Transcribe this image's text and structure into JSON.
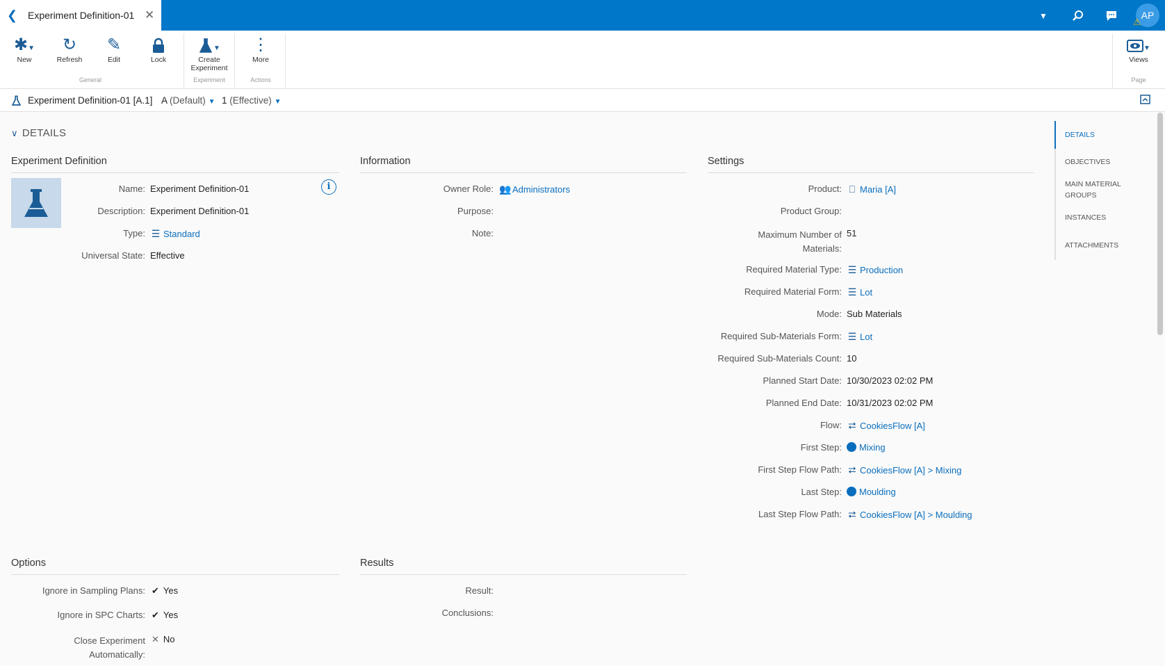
{
  "tab": {
    "title": "Experiment Definition-01"
  },
  "user": {
    "initials": "AP"
  },
  "ribbon": {
    "buttons": [
      "New",
      "Refresh",
      "Edit",
      "Lock",
      "Create Experiment",
      "More",
      "Views"
    ],
    "groups": [
      "General",
      "Experiment",
      "Actions",
      "Page"
    ]
  },
  "header": {
    "entity": "Experiment Definition-01 [A.1]",
    "revision_key": "A",
    "revision": "(Default)",
    "version_key": "1",
    "version": "(Effective)"
  },
  "section": {
    "title": "DETAILS"
  },
  "experiment_definition": {
    "heading": "Experiment Definition",
    "fields": [
      {
        "label": "Name:",
        "value": "Experiment Definition-01"
      },
      {
        "label": "Description:",
        "value": "Experiment Definition-01"
      },
      {
        "label": "Type:",
        "value": "Standard"
      },
      {
        "label": "Universal State:",
        "value": "Effective"
      }
    ]
  },
  "information": {
    "heading": "Information",
    "fields": [
      {
        "label": "Owner Role:",
        "value": "Administrators"
      },
      {
        "label": "Purpose:",
        "value": ""
      },
      {
        "label": "Note:",
        "value": ""
      }
    ]
  },
  "settings": {
    "heading": "Settings",
    "fields": [
      {
        "label": "Product:",
        "value": "Maria [A]"
      },
      {
        "label": "Product Group:",
        "value": ""
      },
      {
        "label_l1": "Maximum Number of",
        "label_l2": "Materials:",
        "value": "51"
      },
      {
        "label": "Required Material Type:",
        "value": "Production"
      },
      {
        "label": "Required Material Form:",
        "value": "Lot"
      },
      {
        "label": "Mode:",
        "value": "Sub Materials"
      },
      {
        "label": "Required Sub-Materials Form:",
        "value": "Lot"
      },
      {
        "label": "Required Sub-Materials Count:",
        "value": "10"
      },
      {
        "label": "Planned Start Date:",
        "value": "10/30/2023 02:02 PM"
      },
      {
        "label": "Planned End Date:",
        "value": "10/31/2023 02:02 PM"
      },
      {
        "label": "Flow:",
        "value": "CookiesFlow [A]"
      },
      {
        "label": "First Step:",
        "value": "Mixing"
      },
      {
        "label": "First Step Flow Path:",
        "value": "CookiesFlow [A] > Mixing"
      },
      {
        "label": "Last Step:",
        "value": "Moulding"
      },
      {
        "label": "Last Step Flow Path:",
        "value": "CookiesFlow [A] > Moulding"
      }
    ]
  },
  "options": {
    "heading": "Options",
    "fields": [
      {
        "label": "Ignore in Sampling Plans:",
        "value": "Yes"
      },
      {
        "label": "Ignore in SPC Charts:",
        "value": "Yes"
      },
      {
        "label_l1": "Close Experiment",
        "label_l2": "Automatically:",
        "value": "No"
      }
    ]
  },
  "results": {
    "heading": "Results",
    "fields": [
      {
        "label": "Result:",
        "value": ""
      },
      {
        "label": "Conclusions:",
        "value": ""
      }
    ]
  },
  "right_nav": [
    "DETAILS",
    "OBJECTIVES",
    "MAIN MATERIAL",
    "GROUPS",
    "INSTANCES",
    "ATTACHMENTS"
  ],
  "colors": {
    "brand": "#0077c8",
    "link": "#0a6ebd"
  }
}
